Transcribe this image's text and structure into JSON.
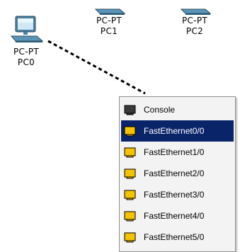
{
  "devices": [
    {
      "id": "pc0",
      "type_label": "PC-PT",
      "name": "PC0",
      "icon": "pc-computer-icon"
    },
    {
      "id": "pc1",
      "type_label": "PC-PT",
      "name": "PC1",
      "icon": "pc-computer-icon"
    },
    {
      "id": "pc2",
      "type_label": "PC-PT",
      "name": "PC2",
      "icon": "pc-computer-icon"
    }
  ],
  "cable": {
    "style": "dashed",
    "color": "#000000"
  },
  "port_menu": {
    "items": [
      {
        "label": "Console",
        "icon": "console-port-icon",
        "icon_color": "#3a3a3a",
        "selected": false
      },
      {
        "label": "FastEthernet0/0",
        "icon": "ethernet-port-icon",
        "icon_color": "#f5c400",
        "selected": true
      },
      {
        "label": "FastEthernet1/0",
        "icon": "ethernet-port-icon",
        "icon_color": "#f5c400",
        "selected": false
      },
      {
        "label": "FastEthernet2/0",
        "icon": "ethernet-port-icon",
        "icon_color": "#f5c400",
        "selected": false
      },
      {
        "label": "FastEthernet3/0",
        "icon": "ethernet-port-icon",
        "icon_color": "#f5c400",
        "selected": false
      },
      {
        "label": "FastEthernet4/0",
        "icon": "ethernet-port-icon",
        "icon_color": "#f5c400",
        "selected": false
      },
      {
        "label": "FastEthernet5/0",
        "icon": "ethernet-port-icon",
        "icon_color": "#f5c400",
        "selected": false
      }
    ],
    "selected_color": "#0a246a"
  }
}
